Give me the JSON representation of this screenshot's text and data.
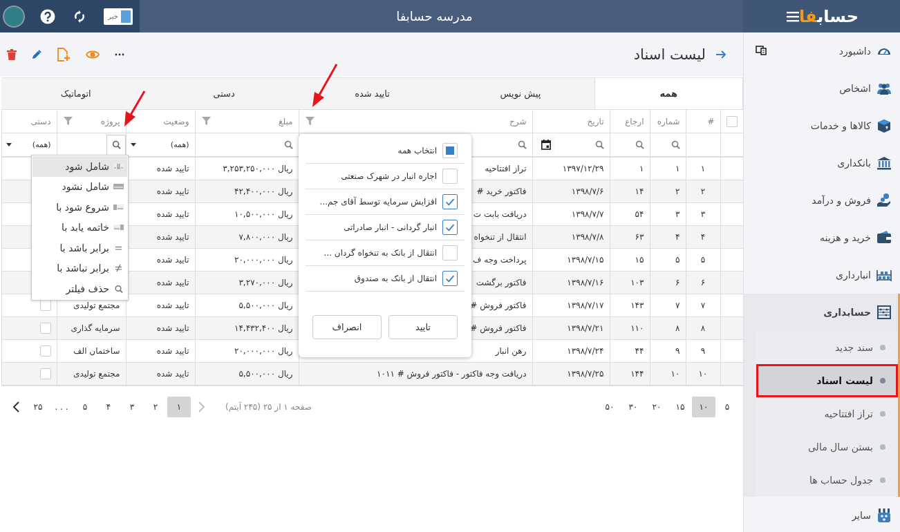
{
  "topbar": {
    "logo": {
      "text": "حساب",
      "accent": "فا"
    },
    "title": "مدرسه حسابفا",
    "toggle": {
      "label": "خیر",
      "on": false
    }
  },
  "sidebar": {
    "items": [
      {
        "label": "داشبورد",
        "expanded": false
      },
      {
        "label": "اشخاص",
        "expanded": false
      },
      {
        "label": "کالاها و خدمات",
        "expanded": false
      },
      {
        "label": "بانکداری",
        "expanded": false
      },
      {
        "label": "فروش و درآمد",
        "expanded": false
      },
      {
        "label": "خرید و هزینه",
        "expanded": false
      },
      {
        "label": "انبارداری",
        "expanded": false
      },
      {
        "label": "حسابداری",
        "expanded": true,
        "children": [
          {
            "label": "سند جدید",
            "selected": false
          },
          {
            "label": "لیست اسناد",
            "selected": true
          },
          {
            "label": "تراز افتتاحیه",
            "selected": false
          },
          {
            "label": "بستن سال مالی",
            "selected": false
          },
          {
            "label": "جدول حساب ها",
            "selected": false
          }
        ]
      },
      {
        "label": "سایر",
        "expanded": false
      }
    ]
  },
  "page": {
    "title": "لیست اسناد"
  },
  "tabs": [
    {
      "label": "همه",
      "selected": true
    },
    {
      "label": "پیش نویس",
      "selected": false
    },
    {
      "label": "تایید شده",
      "selected": false
    },
    {
      "label": "دستی",
      "selected": false
    },
    {
      "label": "اتوماتیک",
      "selected": false
    }
  ],
  "table": {
    "columns": [
      {
        "kind": "select",
        "checked": false,
        "funnel": false
      },
      {
        "label": "#",
        "funnel": false
      },
      {
        "label": "شماره",
        "funnel": false,
        "filter": {
          "kind": "search"
        }
      },
      {
        "label": "ارجاع",
        "funnel": false,
        "filter": {
          "kind": "search"
        }
      },
      {
        "label": "تاریخ",
        "funnel": false,
        "filter": {
          "kind": "date"
        }
      },
      {
        "label": "شرح",
        "funnel": true,
        "filter": {
          "kind": "search"
        }
      },
      {
        "label": "مبلغ",
        "funnel": true,
        "filter": {
          "kind": "search"
        }
      },
      {
        "label": "وضعیت",
        "funnel": false,
        "filter": {
          "kind": "select",
          "value": "(همه)"
        }
      },
      {
        "label": "پروژه",
        "funnel": true,
        "filter": {
          "kind": "search-active"
        }
      },
      {
        "label": "دستی",
        "funnel": false,
        "filter": {
          "kind": "select",
          "value": "(همه)"
        }
      }
    ],
    "rows": [
      {
        "index": "۱",
        "number": "۱",
        "ref": "۱",
        "date": "۱۳۹۷/۱۲/۲۹",
        "description": "تراز افتتاحیه",
        "amount": "ریال ۳,۲۵۳,۲۵۰,۰۰۰",
        "status": "تایید شده"
      },
      {
        "index": "۲",
        "number": "۲",
        "ref": "۱۴",
        "date": "۱۳۹۸/۷/۶",
        "description": "فاکتور خرید #",
        "amount": "ریال ۴۲,۴۰۰,۰۰۰",
        "status": "تایید شده"
      },
      {
        "index": "۳",
        "number": "۳",
        "ref": "۵۴",
        "date": "۱۳۹۸/۷/۷",
        "description": "دریافت بابت ت",
        "amount": "ریال ۱۰,۵۰۰,۰۰۰",
        "status": "تایید شده"
      },
      {
        "index": "۴",
        "number": "۴",
        "ref": "۶۳",
        "date": "۱۳۹۸/۷/۸",
        "description": "انتقال از تنخواه",
        "amount": "ریال ۷,۸۰۰,۰۰۰",
        "status": "تایید شده"
      },
      {
        "index": "۵",
        "number": "۵",
        "ref": "۱۵",
        "date": "۱۳۹۸/۷/۱۵",
        "description": "پرداخت وجه ف",
        "amount": "ریال ۲۰,۰۰۰,۰۰۰",
        "status": "تایید شده"
      },
      {
        "index": "۶",
        "number": "۶",
        "ref": "۱۰۳",
        "date": "۱۳۹۸/۷/۱۶",
        "description": "فاکتور برگشت",
        "amount": "ریال ۳,۲۷۰,۰۰۰",
        "status": "تایید شده"
      },
      {
        "index": "۷",
        "number": "۷",
        "ref": "۱۴۳",
        "date": "۱۳۹۸/۷/۱۷",
        "description": "فاکتور فروش #",
        "amount": "ریال ۵,۵۰۰,۰۰۰",
        "status": "تایید شده",
        "project": "مجتمع تولیدی",
        "manual": false
      },
      {
        "index": "۸",
        "number": "۸",
        "ref": "۱۱۰",
        "date": "۱۳۹۸/۷/۲۱",
        "description": "فاکتور فروش #",
        "amount": "ریال ۱۴,۴۳۲,۴۰۰",
        "status": "تایید شده",
        "project": "سرمایه گذاری",
        "manual": false
      },
      {
        "index": "۹",
        "number": "۹",
        "ref": "۴۴",
        "date": "۱۳۹۸/۷/۲۴",
        "description": "رهن انبار",
        "amount": "ریال ۲۰,۰۰۰,۰۰۰",
        "status": "تایید شده",
        "project": "ساختمان الف",
        "manual": false
      },
      {
        "index": "۱۰",
        "number": "۱۰",
        "ref": "۱۴۴",
        "date": "۱۳۹۸/۷/۲۵",
        "description": "دریافت وجه فاکتور - فاکتور فروش # ۱۰۱۱",
        "amount": "ریال ۵,۵۰۰,۰۰۰",
        "status": "تایید شده",
        "project": "مجتمع تولیدی",
        "manual": false
      }
    ]
  },
  "filter_popup": {
    "items": [
      {
        "label": "انتخاب همه",
        "checked": false,
        "indeterminate": true
      },
      {
        "label": "اجاره انبار در شهرک صنعتی",
        "checked": false
      },
      {
        "label": "افزایش سرمایه توسط آقای جم...",
        "checked": true
      },
      {
        "label": "انبار گردانی - انبار صادراتی",
        "checked": true
      },
      {
        "label": "انتقال از بانک به تنخواه گردان ...",
        "checked": false
      },
      {
        "label": "انتقال از بانک به صندوق",
        "checked": true
      }
    ],
    "buttons": [
      "تایید",
      "انصراف"
    ]
  },
  "operator_menu": {
    "items": [
      {
        "label": "شامل شود",
        "kind": "contains",
        "selected": true
      },
      {
        "label": "شامل نشود",
        "kind": "not-contains",
        "selected": false
      },
      {
        "label": "شروع شود با",
        "kind": "starts-with",
        "selected": false
      },
      {
        "label": "خاتمه یابد با",
        "kind": "ends-with",
        "selected": false
      },
      {
        "label": "برابر باشد با",
        "kind": "equal",
        "selected": false
      },
      {
        "label": "برابر نباشد با",
        "kind": "not-equal",
        "selected": false
      },
      {
        "label": "حذف فیلتر",
        "kind": "clear",
        "selected": false
      }
    ]
  },
  "pagination": {
    "sizes": [
      {
        "label": "۵",
        "selected": false
      },
      {
        "label": "۱۰",
        "selected": true
      },
      {
        "label": "۱۵",
        "selected": false
      },
      {
        "label": "۲۰",
        "selected": false
      },
      {
        "label": "۳۰",
        "selected": false
      },
      {
        "label": "۵۰",
        "selected": false
      }
    ],
    "info": "صفحه ۱ از ۲۵ (۲۴۵ آیتم)",
    "prev": {
      "disabled": true
    },
    "pages": [
      {
        "label": "۱",
        "selected": true
      },
      {
        "label": "۲",
        "selected": false
      },
      {
        "label": "۳",
        "selected": false
      },
      {
        "label": "۴",
        "selected": false
      },
      {
        "label": "۵",
        "selected": false
      },
      {
        "label": ". . .",
        "selected": false
      },
      {
        "label": "۲۵",
        "selected": false
      }
    ],
    "next": {
      "disabled": false
    }
  }
}
